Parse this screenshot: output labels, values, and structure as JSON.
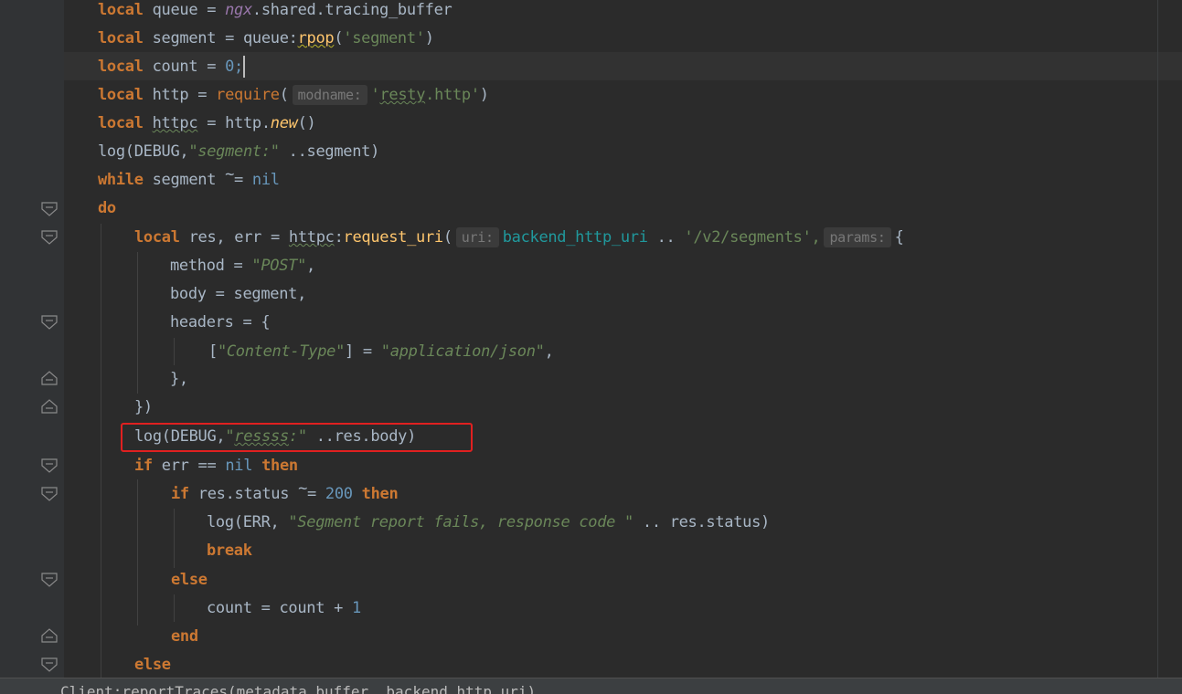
{
  "editor": {
    "lines": {
      "l1": {
        "a": "local",
        "b": " queue = ",
        "c": "ngx",
        "d": ".shared.tracing_buffer"
      },
      "l2": {
        "a": "local",
        "b": " segment = queue:",
        "c": "rpop",
        "d": "(",
        "e": "'segment'",
        "f": ")"
      },
      "l3": {
        "a": "local",
        "b": " count = ",
        "c": "0;"
      },
      "l4": {
        "a": "local",
        "b": " http = ",
        "c": "require",
        "d": "(",
        "hint": "modname:",
        "e": "'",
        "f": "resty",
        "g": ".http'",
        "h": ")"
      },
      "l5": {
        "a": "local",
        "b": " ",
        "c": "httpc",
        "d": " = http.",
        "e": "new",
        "f": "()"
      },
      "l6": {
        "a": "log(DEBUG,",
        "b": "\"segment:\"",
        "c": " ..segment)"
      },
      "l7": {
        "a": "while",
        "b": " segment ",
        "c": "~",
        "d": "= ",
        "e": "nil"
      },
      "l8": {
        "a": "do"
      },
      "l9": {
        "a": "local",
        "b": " res, err = ",
        "c": "httpc",
        "d": ":",
        "e": "request_uri",
        "f": "(",
        "hint1": "uri:",
        "g": "backend_http_uri",
        "h": " .. ",
        "i": "'/v2/segments',",
        "hint2": "params:",
        "j": "{"
      },
      "l10": {
        "a": "method = ",
        "b": "\"POST\"",
        "c": ","
      },
      "l11": {
        "a": "body = segment,"
      },
      "l12": {
        "a": "headers = {"
      },
      "l13": {
        "a": "[",
        "b": "\"Content-Type\"",
        "c": "] = ",
        "d": "\"application/json\"",
        "e": ","
      },
      "l14": {
        "a": "},"
      },
      "l15": {
        "a": "})"
      },
      "l16": {
        "a": "log(DEBUG,",
        "b": "\"",
        "c": "ressss",
        "d": ":\"",
        "e": " ..res.body)"
      },
      "l17": {
        "a": "if",
        "b": " err == ",
        "c": "nil",
        "d": " ",
        "e": "then"
      },
      "l18": {
        "a": "if",
        "b": " res.status ",
        "c": "~",
        "d": "= ",
        "e": "200",
        "f": " ",
        "g": "then"
      },
      "l19": {
        "a": "log(ERR, ",
        "b": "\"Segment report fails, response code \"",
        "c": " .. res.status)"
      },
      "l20": {
        "a": "break"
      },
      "l21": {
        "a": "else"
      },
      "l22": {
        "a": "count = count + ",
        "b": "1"
      },
      "l23": {
        "a": "end"
      },
      "l24": {
        "a": "else"
      }
    }
  },
  "breadcrumb": {
    "text": "Client:reportTraces(metadata_buffer, backend_http_uri)"
  },
  "colors": {
    "background": "#2b2b2b",
    "keyword": "#cc7832",
    "string": "#6a8759",
    "number": "#6897bb",
    "highlight": "#e02020"
  }
}
